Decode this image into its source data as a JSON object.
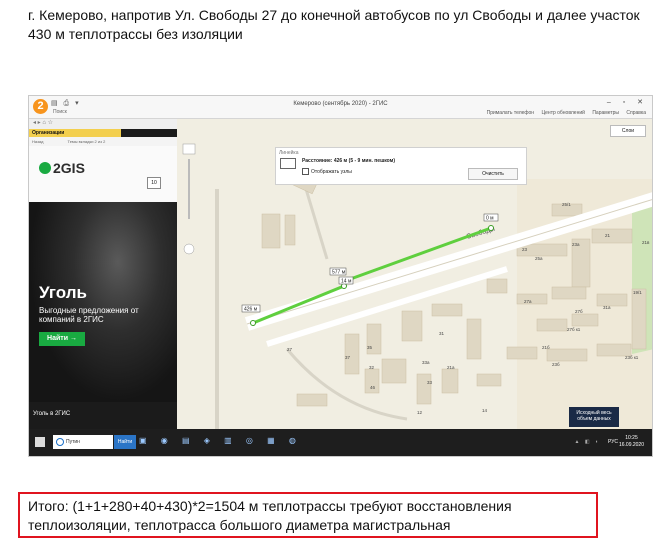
{
  "heading": "г. Кемерово, напротив  Ул. Свободы 27 до конечной автобусов по ул Свободы и далее  участок 430 м теплотрассы без изоляции",
  "summary": "Итого: (1+1+280+40+430)*2=1504 м теплотрассы требуют восстановления теплоизоляции, теплотрасса большого диаметра магистральная",
  "app": {
    "window_title": "Кемерово (сентябрь 2020) - 2ГИС",
    "logo": "2",
    "search_tab": "Поиск",
    "toolbar_right": [
      "Прималать телефон",
      "Центр обновлений",
      "Параметры",
      "Справка"
    ],
    "layers_button": "Слои"
  },
  "sidebar": {
    "tab_organizations": "Организации",
    "sub_tabs": [
      "Назад",
      "Темы вкладки 2 из 2"
    ],
    "brand": "2GIS",
    "ad_close": "10",
    "ad_title": "Уголь",
    "ad_desc": "Выгодные предложения от компаний в 2ГИС",
    "ad_button": "Найти →",
    "ad_footer": "Уголь в 2ГИС"
  },
  "ruler": {
    "title": "Линейка",
    "distance": "Расстояние: 426 м (5 - 9 мин. пешком)",
    "show_nodes": "Отображать узлы",
    "clear_button": "Очистить"
  },
  "map": {
    "street": "Свободы",
    "route_labels": [
      "0 м",
      "577 м",
      "14 м",
      "426 м"
    ],
    "building_labels": [
      "25/1",
      "21",
      "23а",
      "25а",
      "23",
      "27а",
      "27б",
      "27б к1",
      "27",
      "21а",
      "31",
      "35",
      "37",
      "33",
      "33а",
      "46",
      "12",
      "14",
      "31а",
      "21б",
      "23б",
      "19/1",
      "23б к1",
      "41",
      "21в",
      "32"
    ],
    "promo": "Исходный весь объем данных"
  },
  "taskbar": {
    "search_placeholder": "Путин",
    "find_button": "Найти",
    "lang": "РУС",
    "time": "10:25",
    "date": "16.09.2020"
  },
  "colors": {
    "route": "#5fcf3e",
    "street": "#ffffff",
    "building": "#dfd7c3",
    "summary_border": "#e0141f",
    "brand_green": "#19aa41"
  }
}
